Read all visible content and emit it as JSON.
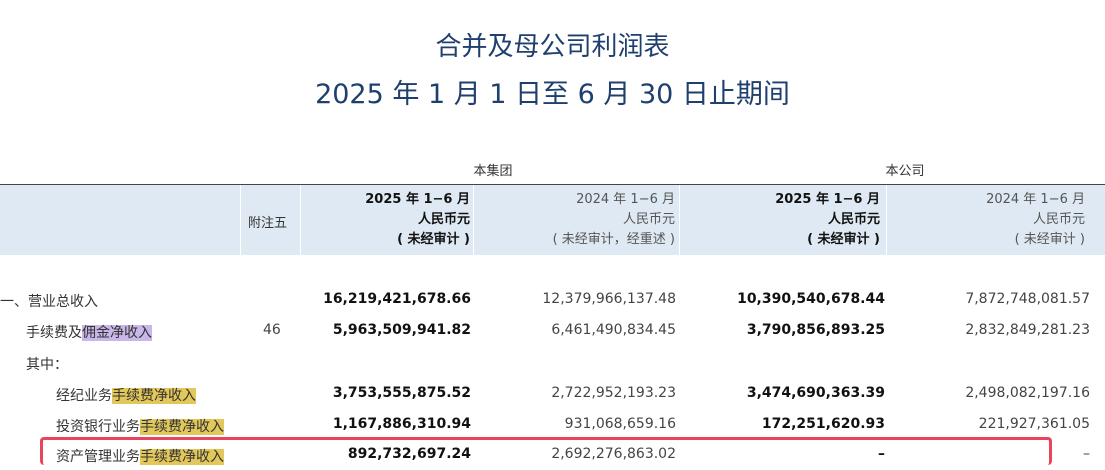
{
  "title": "合并及母公司利润表",
  "period": "2025 年 1 月 1 日至 6 月 30 日止期间",
  "groups": {
    "group": "本集团",
    "company": "本公司"
  },
  "columns": {
    "note": "附注五",
    "c1": {
      "period": "2025 年 1−6 月",
      "currency": "人民币元",
      "note": "( 未经审计 )"
    },
    "c2": {
      "period": "2024 年 1−6 月",
      "currency": "人民币元",
      "note": "( 未经审计，经重述 )"
    },
    "c3": {
      "period": "2025 年 1−6 月",
      "currency": "人民币元",
      "note": "( 未经审计 )"
    },
    "c4": {
      "period": "2024 年 1−6 月",
      "currency": "人民币元",
      "note": "( 未经审计 )"
    }
  },
  "rows": [
    {
      "label": "一、营业总收入",
      "note": "",
      "v1": "16,219,421,678.66",
      "v2": "12,379,966,137.48",
      "v3": "10,390,540,678.44",
      "v4": "7,872,748,081.57"
    },
    {
      "label_a": "手续费及",
      "label_b": "佣金净收入",
      "note": "46",
      "v1": "5,963,509,941.82",
      "v2": "6,461,490,834.45",
      "v3": "3,790,856,893.25",
      "v4": "2,832,849,281.23"
    },
    {
      "label": "其中："
    },
    {
      "label_a": "经纪业务",
      "label_b": "手续费净收入",
      "note": "",
      "v1": "3,753,555,875.52",
      "v2": "2,722,952,193.23",
      "v3": "3,474,690,363.39",
      "v4": "2,498,082,197.16"
    },
    {
      "label_a": "投资银行业务",
      "label_b": "手续费净收入",
      "note": "",
      "v1": "1,167,886,310.94",
      "v2": "931,068,659.16",
      "v3": "172,251,620.93",
      "v4": "221,927,361.05"
    },
    {
      "label_a": "资产管理业务",
      "label_b": "手续费净收入",
      "note": "",
      "v1": "892,732,697.24",
      "v2": "2,692,276,863.02",
      "v3": "–",
      "v4": "–"
    }
  ],
  "colors": {
    "title": "#1f3f6e",
    "header_band": "#dfe9f3",
    "highlight_purple": "#c9b6ea",
    "highlight_yellow": "#e2c75a",
    "annotation_box": "#e8455c"
  }
}
